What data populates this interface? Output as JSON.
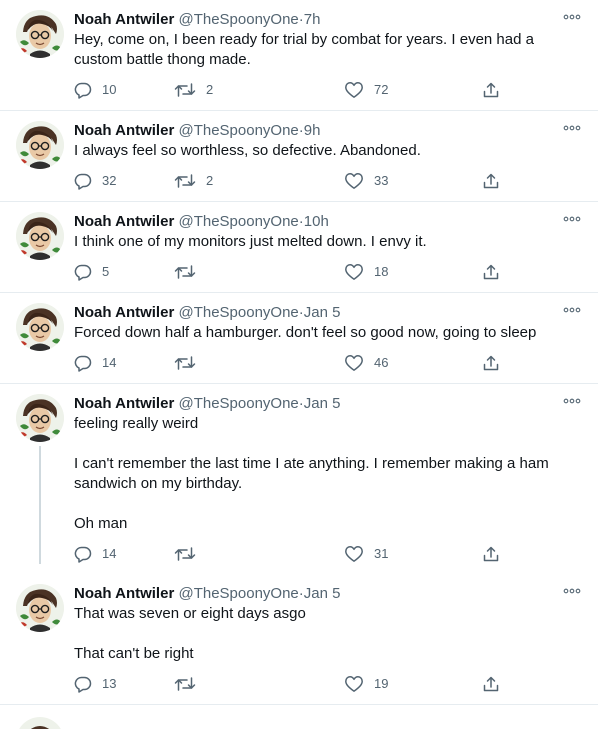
{
  "tweets": [
    {
      "name": "Noah Antwiler",
      "handle": "@TheSpoonyOne",
      "separator": "·",
      "time": "7h",
      "paragraphs": [
        "Hey, come on, I been ready for trial by combat for years. I even had a custom battle thong made."
      ],
      "replies": "10",
      "retweets": "2",
      "likes": "72",
      "thread_line": false
    },
    {
      "name": "Noah Antwiler",
      "handle": "@TheSpoonyOne",
      "separator": "·",
      "time": "9h",
      "paragraphs": [
        "I always feel so worthless, so defective. Abandoned."
      ],
      "replies": "32",
      "retweets": "2",
      "likes": "33",
      "thread_line": false
    },
    {
      "name": "Noah Antwiler",
      "handle": "@TheSpoonyOne",
      "separator": "·",
      "time": "10h",
      "paragraphs": [
        "I think one of my monitors just melted down. I envy it."
      ],
      "replies": "5",
      "retweets": "",
      "likes": "18",
      "thread_line": false
    },
    {
      "name": "Noah Antwiler",
      "handle": "@TheSpoonyOne",
      "separator": "·",
      "time": "Jan 5",
      "paragraphs": [
        "Forced down half a hamburger. don't feel so good now, going to sleep"
      ],
      "replies": "14",
      "retweets": "",
      "likes": "46",
      "thread_line": false
    },
    {
      "name": "Noah Antwiler",
      "handle": "@TheSpoonyOne",
      "separator": "·",
      "time": "Jan 5",
      "paragraphs": [
        "feeling really weird",
        "I can't remember the last time I ate anything. I remember making a ham sandwich on my birthday.",
        "Oh man"
      ],
      "replies": "14",
      "retweets": "",
      "likes": "31",
      "thread_line": true
    },
    {
      "name": "Noah Antwiler",
      "handle": "@TheSpoonyOne",
      "separator": "·",
      "time": "Jan 5",
      "paragraphs": [
        "That was seven or eight days asgo",
        "That can't be right"
      ],
      "replies": "13",
      "retweets": "",
      "likes": "19",
      "thread_line": false
    }
  ],
  "icons": {
    "reply": "reply-icon",
    "retweet": "retweet-icon",
    "like": "heart-icon",
    "share": "share-icon",
    "more": "more-options-icon",
    "avatar": "avatar"
  },
  "colors": {
    "text": "#0f1419",
    "secondary": "#536471",
    "divider": "#e6ecf0",
    "thread_line": "#cfd9de",
    "background": "#ffffff"
  }
}
